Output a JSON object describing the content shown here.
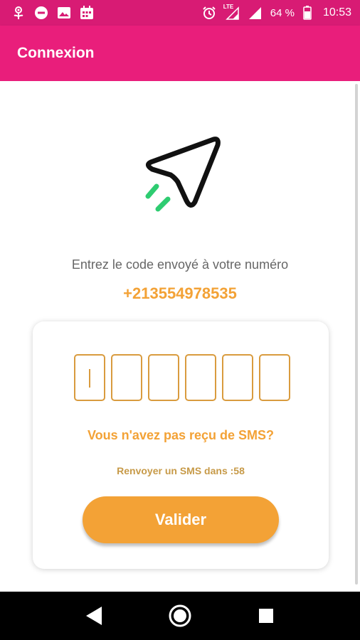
{
  "status_bar": {
    "left_icons": [
      "flower-icon",
      "do-not-disturb-icon",
      "image-icon",
      "calendar-icon"
    ],
    "right_icons": [
      "alarm-icon",
      "lte-signal-icon",
      "signal-icon",
      "battery-icon"
    ],
    "network": "LTE",
    "battery": "64 %",
    "time": "10:53"
  },
  "app_bar": {
    "title": "Connexion"
  },
  "main": {
    "logo_icon": "paper-plane-icon",
    "prompt": "Entrez le code envoyé à votre numéro",
    "phone_number": "+213554978535"
  },
  "card": {
    "otp_digits": [
      "",
      "",
      "",
      "",
      "",
      ""
    ],
    "no_sms_label": "Vous n'avez pas reçu de SMS?",
    "resend_label": "Renvoyer un SMS dans :58",
    "submit_label": "Valider"
  },
  "nav_bar": {
    "buttons": [
      "back-icon",
      "home-icon",
      "recents-icon"
    ]
  },
  "colors": {
    "status_bar": "#d81b74",
    "app_bar": "#e91e7b",
    "accent_orange": "#f3a236",
    "otp_border": "#d99b3e",
    "logo_green": "#2ecc71"
  }
}
